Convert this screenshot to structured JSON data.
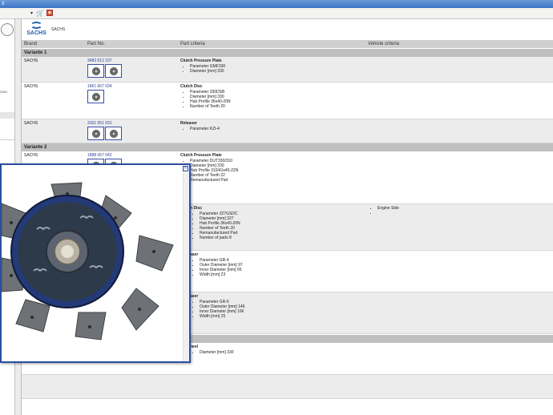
{
  "window": {
    "title": "3"
  },
  "colors": {
    "accent": "#2b4fa0",
    "sachs_blue": "#1f5fb0",
    "variant_bg": "#bfbfbf",
    "header_bg": "#cfcfcf"
  },
  "toolbar": {
    "icons": [
      "dropdown-arrow-icon",
      "cart-icon",
      "stop-icon"
    ]
  },
  "left_panel": {
    "text": "ZUM"
  },
  "brand_bar": {
    "logo_text": "SACHS",
    "brand_name": "SACHS"
  },
  "columns": {
    "brand": "Brand",
    "part_no": "Part No.",
    "criteria": "Part criteria",
    "vehicle": "Vehicle criteria"
  },
  "variants": [
    {
      "label": "Variante 1",
      "rows": [
        {
          "brand": "SACHS",
          "part_no": "3482 012 237",
          "title": "Clutch Pressure Plate",
          "criteria": [
            "Parameter GMF330",
            "Diameter [mm] 330"
          ]
        },
        {
          "brand": "SACHS",
          "part_no": "1861 667 034",
          "title": "Clutch Disc",
          "criteria": [
            "Parameter 330DSB",
            "Diameter [mm] 330",
            "Hub Profile 36x40-20N",
            "Number of Teeth 20"
          ]
        },
        {
          "brand": "SACHS",
          "part_no": "3151 051 031",
          "title": "Releaser",
          "criteria": [
            "Parameter KZI-4"
          ]
        }
      ]
    },
    {
      "label": "Variante 2",
      "rows": [
        {
          "brand": "SACHS",
          "part_no": "1888 067 042",
          "title": "Clutch Pressure Plate",
          "criteria": [
            "Parameter DUT330/310",
            "Diameter [mm] 330",
            "Hub Profile 310/41x45-22N",
            "Number of Teeth 22",
            "Remanufactured Part"
          ]
        },
        {
          "title": "h Disc",
          "criteria": [
            "Parameter 327GSDC",
            "Diameter [mm] 327",
            "Hub Profile 36x40-20N",
            "Number of Teeth 20",
            "Remanufactured Part",
            "Number of pads 8"
          ],
          "vehicle": [
            "Engine Side",
            ""
          ]
        },
        {
          "title": "aser",
          "criteria": [
            "Parameter GR-4",
            "Outer Diameter [mm] 97",
            "Inner Diameter [mm] 65",
            "Width [mm] 23"
          ]
        },
        {
          "title": "aser",
          "criteria": [
            "Parameter GR-6",
            "Outer Diameter [mm] 146",
            "Inner Diameter [mm] 106",
            "Width [mm] 25"
          ]
        }
      ]
    },
    {
      "label": "",
      "rows": [
        {
          "title": "heel",
          "criteria": [
            "Diameter [mm] 330"
          ]
        }
      ]
    }
  ],
  "popup": {
    "close": "×",
    "image": "clutch-disc-image"
  }
}
